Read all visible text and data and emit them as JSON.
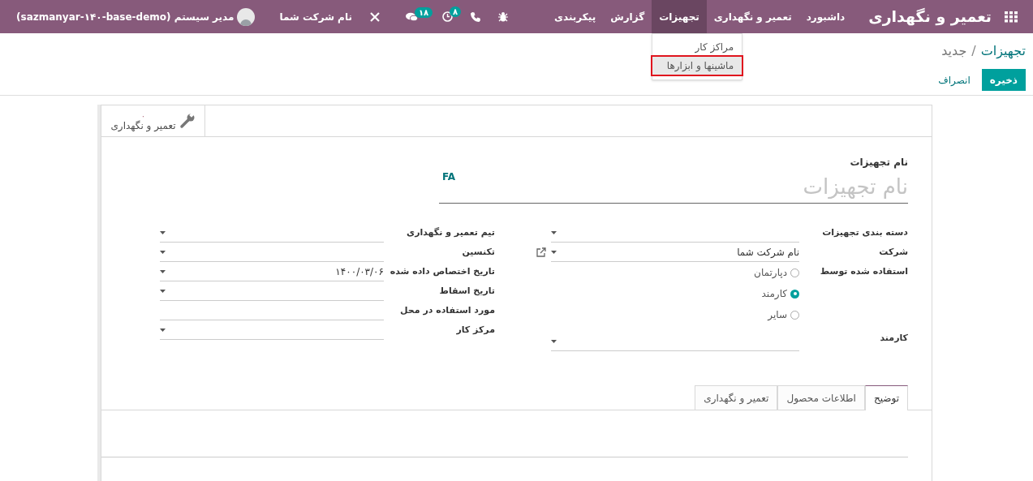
{
  "navbar": {
    "app_title": "تعمیر و نگهداری",
    "menu": [
      {
        "label": "داشبورد",
        "selected": false
      },
      {
        "label": "تعمیر و نگهداری",
        "selected": false
      },
      {
        "label": "تجهیزات",
        "selected": true
      },
      {
        "label": "گزارش",
        "selected": false
      },
      {
        "label": "پیکربندی",
        "selected": false
      }
    ],
    "activity_count": "۸",
    "message_count": "۱۸",
    "company": "نام شرکت شما",
    "user": "مدیر سیستم (sazmanyar-۱۴۰-base-demo)"
  },
  "dropdown": {
    "items": [
      {
        "label": "مراکز کار",
        "highlighted": false
      },
      {
        "label": "ماشینها و ابزارها",
        "highlighted": true
      }
    ]
  },
  "breadcrumb": {
    "parent": "تجهیزات",
    "separator": "/",
    "current": "جدید"
  },
  "buttons": {
    "save": "ذخیره",
    "discard": "انصراف"
  },
  "stat_button": {
    "count": "۰",
    "label": "تعمیر و نگهداری"
  },
  "name_field": {
    "label": "نام تجهیزات",
    "placeholder": "نام تجهیزات",
    "lang": "FA"
  },
  "right_fields": [
    {
      "kind": "select",
      "label": "دسته بندی تجهیزات"
    },
    {
      "kind": "select_link",
      "label": "شرکت",
      "value": "نام شرکت شما"
    },
    {
      "kind": "radio",
      "label": "استفاده شده توسط",
      "options": [
        {
          "label": "دپارتمان",
          "selected": false
        },
        {
          "label": "کارمند",
          "selected": true
        },
        {
          "label": "سایر",
          "selected": false
        }
      ]
    },
    {
      "kind": "select",
      "label": "کارمند"
    }
  ],
  "left_fields": [
    {
      "kind": "select",
      "label": "تیم تعمیر و نگهداری"
    },
    {
      "kind": "select",
      "label": "تکنسین"
    },
    {
      "kind": "select",
      "label": "تاریخ اختصاص داده شده",
      "value": "۱۴۰۰/۰۳/۰۶"
    },
    {
      "kind": "select",
      "label": "تاریخ اسقاط"
    },
    {
      "kind": "text",
      "label": "مورد استفاده در محل"
    },
    {
      "kind": "select",
      "label": "مرکز کار"
    }
  ],
  "tabs": [
    {
      "label": "توضیح",
      "selected": true
    },
    {
      "label": "اطلاعات محصول",
      "selected": false
    },
    {
      "label": "تعمیر و نگهداری",
      "selected": false
    }
  ]
}
